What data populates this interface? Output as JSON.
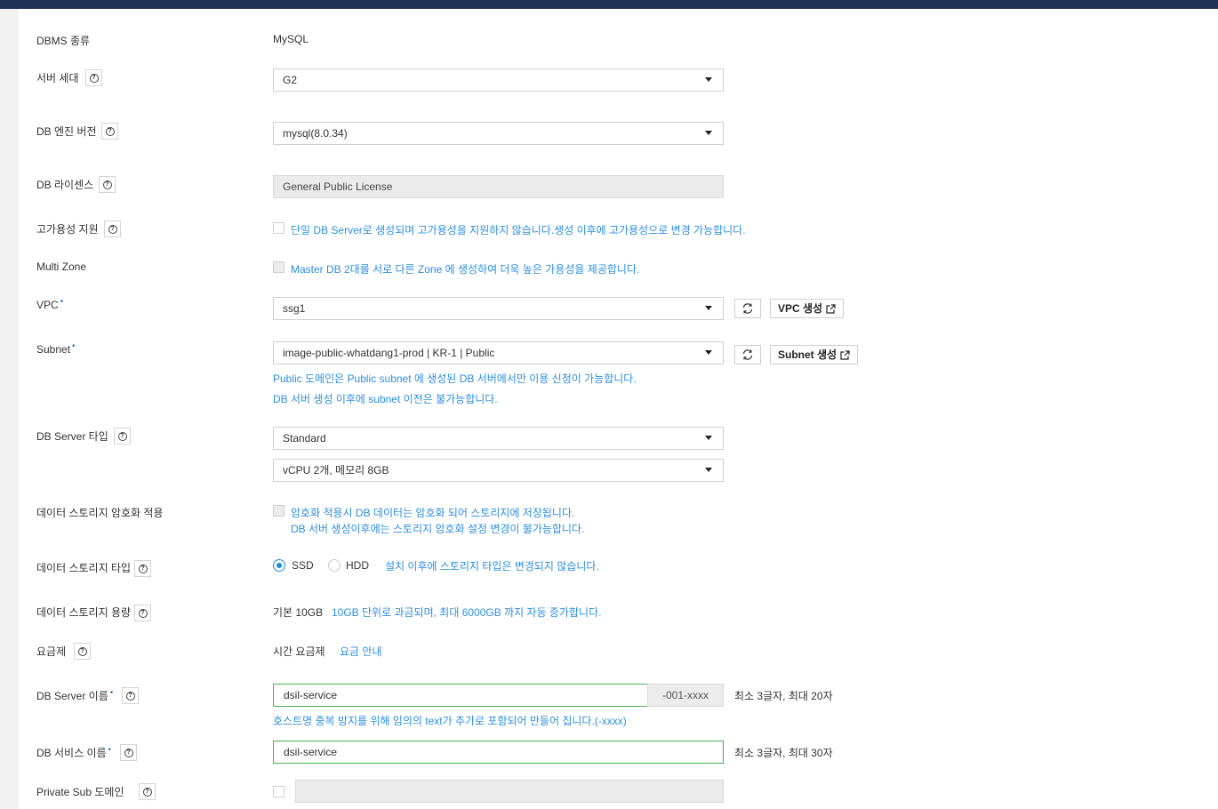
{
  "dbms": {
    "label": "DBMS 종류",
    "value": "MySQL"
  },
  "server_gen": {
    "label": "서버 세대",
    "value": "G2"
  },
  "engine_version": {
    "label": "DB 엔진 버전",
    "value": "mysql(8.0.34)"
  },
  "license": {
    "label": "DB 라이센스",
    "value": "General Public License"
  },
  "ha": {
    "label": "고가용성 지원",
    "text": "단일 DB Server로 생성되며 고가용성을 지원하지 않습니다.생성 이후에 고가용성으로 변경 가능합니다."
  },
  "multizone": {
    "label": "Multi Zone",
    "text": "Master DB 2대를 서로 다른 Zone 에 생성하여 더욱 높은 가용성을 제공합니다."
  },
  "vpc": {
    "label": "VPC",
    "required_mark": "•",
    "value": "ssg1",
    "create_label": "VPC 생성"
  },
  "subnet": {
    "label": "Subnet",
    "required_mark": "•",
    "value": "image-public-whatdang1-prod | KR-1 | Public",
    "create_label": "Subnet 생성",
    "note1": "Public 도메인은 Public subnet 에 생성된 DB 서버에서만 이용 신청이 가능합니다.",
    "note2": "DB 서버 생성 이후에 subnet 이전은 불가능합니다."
  },
  "server_type": {
    "label": "DB Server 타입",
    "value": "Standard",
    "spec": "vCPU 2개, 메모리 8GB"
  },
  "encryption": {
    "label": "데이터 스토리지 암호화 적용",
    "line1": "암호화 적용시 DB 데이터는 암호화 되어 스토리지에 저장됩니다.",
    "line2": "DB 서버 생성이후에는 스토리지 암호화 설정 변경이 불가능합니다."
  },
  "storage_type": {
    "label": "데이터 스토리지 타입",
    "opt1": "SSD",
    "opt2": "HDD",
    "selected": "SSD",
    "note": "설치 이후에 스토리지 타입은 변경되지 않습니다."
  },
  "storage_size": {
    "label": "데이터 스토리지 용량",
    "value": "기본 10GB",
    "note": "10GB 단위로 과금되며, 최대 6000GB 까지 자동 증가합니다."
  },
  "pricing": {
    "label": "요금제",
    "value": "시간 요금제",
    "link": "요금 안내"
  },
  "server_name": {
    "label": "DB Server 이름",
    "required_mark": "•",
    "value": "dsil-service",
    "suffix": "-001-xxxx",
    "hint": "최소 3글자, 최대 20자",
    "note": "호스트명 중복 방지를 위해 임의의 text가 추가로 포함되어 만들어 집니다.(-xxxx)"
  },
  "service_name": {
    "label": "DB 서비스 이름",
    "required_mark": "•",
    "value": "dsil-service",
    "hint": "최소 3글자, 최대 30자"
  },
  "private_sub": {
    "label": "Private Sub 도메인",
    "value": ""
  },
  "colors": {
    "accent": "#2d8ee0",
    "topbar": "#1f3354",
    "valid_border": "#4caf50"
  }
}
